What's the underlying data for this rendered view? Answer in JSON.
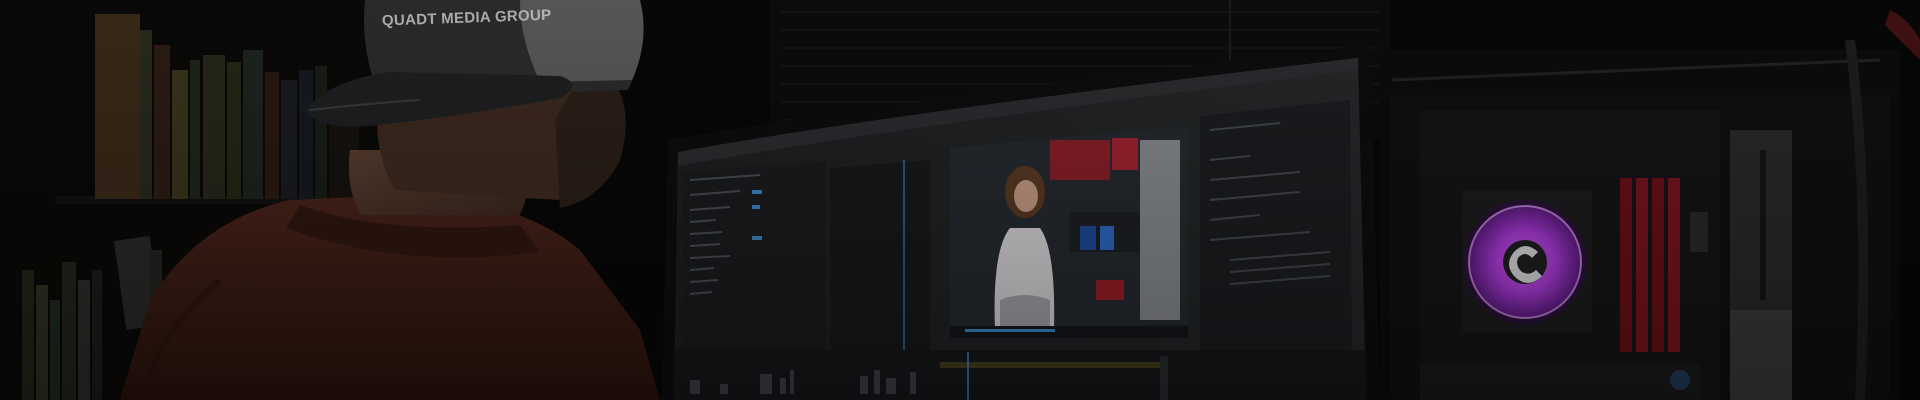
{
  "photo": {
    "cap_logo_text": "QUADT MEDIA GROUP",
    "colors": {
      "background": "#060606",
      "monitor_ui": "#1e2022",
      "panel_accent": "#3a88c8",
      "shirt": "#3a1c14",
      "fan_glow": "#a83ad6"
    },
    "objects": [
      {
        "name": "bookshelf",
        "label": "bookshelf with books"
      },
      {
        "name": "man",
        "label": "man wearing cap, seen from behind"
      },
      {
        "name": "monitor",
        "label": "curved monitor showing a video editing application"
      },
      {
        "name": "pc-case",
        "label": "open PC case with RGB CPU cooler and memory"
      }
    ]
  }
}
